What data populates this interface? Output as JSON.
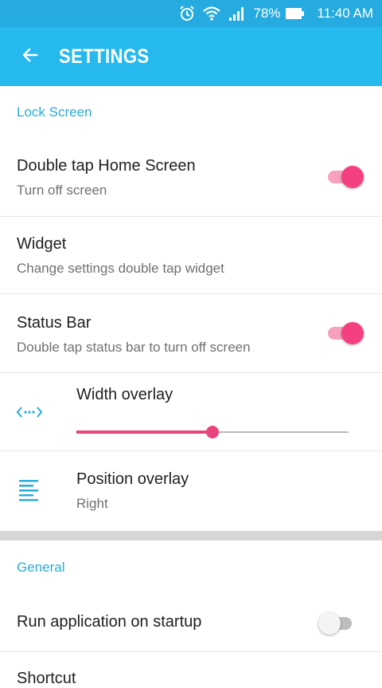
{
  "status_bar": {
    "battery_percent": "78%",
    "time": "11:40 AM",
    "icons": [
      "alarm-icon",
      "wifi-icon",
      "signal-icon",
      "battery-icon"
    ]
  },
  "app_bar": {
    "title": "SETTINGS",
    "back_icon": "arrow-left-icon"
  },
  "sections": {
    "lock_screen": {
      "header": "Lock Screen"
    },
    "general": {
      "header": "General"
    }
  },
  "settings": {
    "double_tap_home": {
      "title": "Double tap Home Screen",
      "subtitle": "Turn off screen",
      "enabled": true
    },
    "widget": {
      "title": "Widget",
      "subtitle": "Change settings double tap widget"
    },
    "status_bar_setting": {
      "title": "Status Bar",
      "subtitle": "Double tap status bar to turn off screen",
      "enabled": true
    },
    "width_overlay": {
      "title": "Width overlay",
      "icon": "width-arrows-icon",
      "value_fraction": 0.5
    },
    "position_overlay": {
      "title": "Position overlay",
      "subtitle": "Right",
      "icon": "align-lines-icon"
    },
    "run_on_startup": {
      "title": "Run application on startup",
      "enabled": false
    },
    "shortcut": {
      "title": "Shortcut"
    }
  },
  "colors": {
    "status_bar": "#25abdf",
    "app_bar": "#25b9ee",
    "accent": "#29acd7",
    "toggle_on": "#f43f80",
    "slider": "#e6457e"
  }
}
